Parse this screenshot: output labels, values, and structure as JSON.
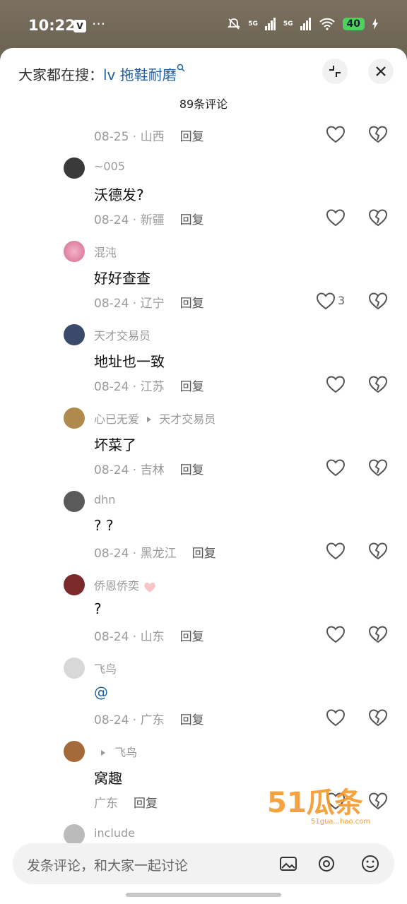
{
  "status_bar": {
    "time": "10:22",
    "app_icon": "V",
    "more": "···",
    "net1": "5G",
    "net2": "5G",
    "battery": "40"
  },
  "header": {
    "search_prefix": "大家都在搜：",
    "search_keyword": "lv 拖鞋耐磨",
    "comment_count": "89条评论"
  },
  "reply_label": "回复",
  "top_meta": {
    "date": "08-25 · 山西"
  },
  "comments": [
    {
      "user": "~005",
      "text": "沃德发?",
      "date": "08-24 · 新疆",
      "likes": ""
    },
    {
      "user": "混沌",
      "text": "好好查查",
      "date": "08-24 · 辽宁",
      "likes": "3"
    },
    {
      "user": "天才交易员",
      "text": "地址也一致",
      "date": "08-24 · 江苏",
      "likes": ""
    },
    {
      "user": "心已无爱",
      "reply_to": "天才交易员",
      "text": "坏菜了",
      "date": "08-24 · 吉林",
      "likes": ""
    },
    {
      "user": "dhn",
      "text": "? ?",
      "date": "08-24 · 黑龙江",
      "likes": ""
    },
    {
      "user": "侨恩侨奕",
      "text": "?",
      "date": "08-24 · 山东",
      "likes": ""
    },
    {
      "user": "飞鸟",
      "text": "@",
      "date": "08-24 · 广东",
      "likes": ""
    },
    {
      "user": "",
      "reply_to": "飞鸟",
      "text": "窝趣",
      "date": "广东",
      "likes": ""
    },
    {
      "user": "include"
    }
  ],
  "input": {
    "placeholder": "发条评论，和大家一起讨论"
  },
  "watermark": {
    "text": "51瓜条",
    "sub": "51gua...hao.com"
  },
  "colors": {
    "link": "#1f5f9e",
    "meta": "#9a9a9a",
    "text": "#111111"
  }
}
